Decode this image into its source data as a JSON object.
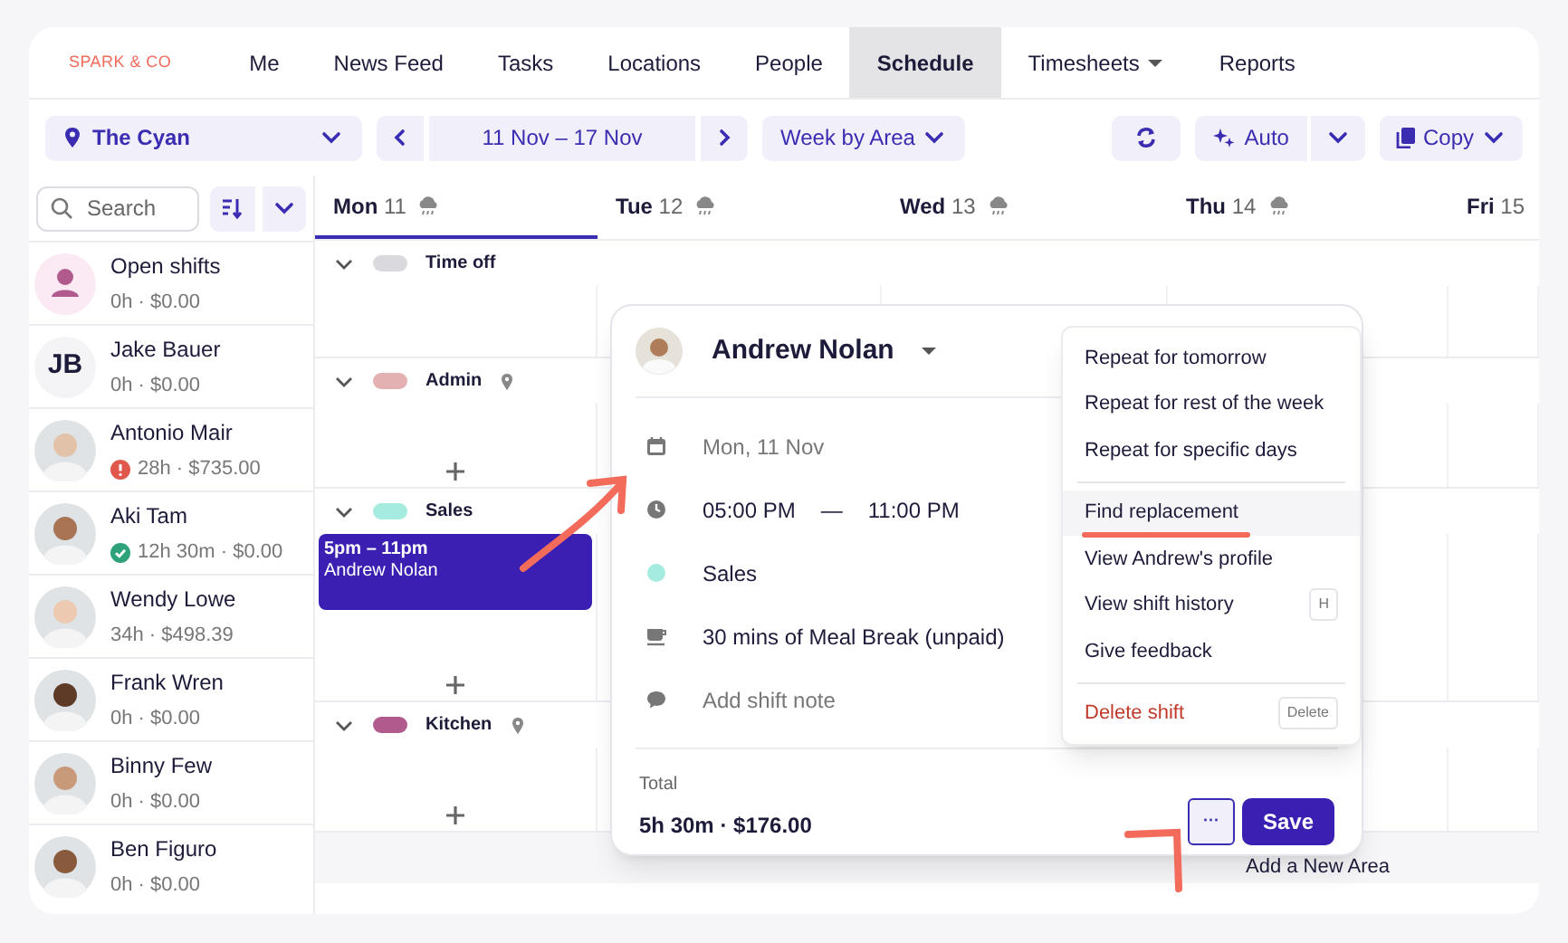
{
  "brand": "SPARK & CO",
  "nav": [
    {
      "label": "Me",
      "selected": false,
      "has_menu": false
    },
    {
      "label": "News Feed",
      "selected": false,
      "has_menu": false
    },
    {
      "label": "Tasks",
      "selected": false,
      "has_menu": false
    },
    {
      "label": "Locations",
      "selected": false,
      "has_menu": false
    },
    {
      "label": "People",
      "selected": false,
      "has_menu": false
    },
    {
      "label": "Schedule",
      "selected": true,
      "has_menu": false
    },
    {
      "label": "Timesheets",
      "selected": false,
      "has_menu": true
    },
    {
      "label": "Reports",
      "selected": false,
      "has_menu": false
    }
  ],
  "toolbar": {
    "location": "The Cyan",
    "date_range": "11 Nov – 17 Nov",
    "view": "Week by Area",
    "auto": "Auto",
    "copy": "Copy"
  },
  "search": {
    "placeholder": "Search"
  },
  "days": [
    {
      "day": "Mon",
      "date": "11",
      "selected": true
    },
    {
      "day": "Tue",
      "date": "12",
      "selected": false
    },
    {
      "day": "Wed",
      "date": "13",
      "selected": false
    },
    {
      "day": "Thu",
      "date": "14",
      "selected": false
    },
    {
      "day": "Fri",
      "date": "15",
      "selected": false
    }
  ],
  "staff": [
    {
      "name": "Open shifts",
      "summary": "0h · $0.00",
      "kind": "open",
      "alert": false,
      "confirmed": false
    },
    {
      "name": "Jake Bauer",
      "summary": "0h · $0.00",
      "kind": "initials",
      "initials": "JB",
      "alert": false,
      "confirmed": false
    },
    {
      "name": "Antonio Mair",
      "summary": "28h · $735.00",
      "kind": "photo",
      "alert": true,
      "confirmed": false
    },
    {
      "name": "Aki Tam",
      "summary": "12h 30m · $0.00",
      "kind": "photo",
      "alert": false,
      "confirmed": true
    },
    {
      "name": "Wendy Lowe",
      "summary": "34h · $498.39",
      "kind": "photo",
      "alert": false,
      "confirmed": false
    },
    {
      "name": "Frank Wren",
      "summary": "0h · $0.00",
      "kind": "photo",
      "alert": false,
      "confirmed": false
    },
    {
      "name": "Binny Few",
      "summary": "0h · $0.00",
      "kind": "photo",
      "alert": false,
      "confirmed": false
    },
    {
      "name": "Ben Figuro",
      "summary": "0h · $0.00",
      "kind": "photo",
      "alert": false,
      "confirmed": false
    }
  ],
  "areas": [
    {
      "name": "Time off",
      "color": "#d9d9de",
      "expanded": true,
      "pinned": false,
      "addable": false
    },
    {
      "name": "Admin",
      "color": "#e3b1b1",
      "expanded": true,
      "pinned": true,
      "addable": true
    },
    {
      "name": "Sales",
      "color": "#a6ebe0",
      "expanded": true,
      "pinned": false,
      "addable": true,
      "shifts": [
        {
          "time": "5pm – 11pm",
          "name": "Andrew Nolan"
        }
      ]
    },
    {
      "name": "Kitchen",
      "color": "#b05a8e",
      "expanded": true,
      "pinned": true,
      "addable": true
    }
  ],
  "add_area": "Add a New Area",
  "popup": {
    "employee": "Andrew Nolan",
    "date": "Mon, 11 Nov",
    "start": "05:00 PM",
    "dash": "—",
    "end": "11:00 PM",
    "area": {
      "label": "Sales",
      "color": "#a6ebe0"
    },
    "break": "30 mins of Meal Break (unpaid)",
    "note_placeholder": "Add shift note",
    "total_label": "Total",
    "total": "5h 30m · $176.00",
    "more": "···",
    "save": "Save"
  },
  "menu": [
    {
      "label": "Repeat for tomorrow",
      "kind": "item",
      "selected": false
    },
    {
      "label": "Repeat for rest of the week",
      "kind": "item",
      "selected": false
    },
    {
      "label": "Repeat for specific days",
      "kind": "item",
      "selected": false
    },
    {
      "label": "Find replacement",
      "kind": "item",
      "selected": true,
      "divider_before": true
    },
    {
      "label": "View Andrew's profile",
      "kind": "item",
      "selected": false
    },
    {
      "label": "View shift history",
      "kind": "item",
      "selected": false,
      "shortcut": "H"
    },
    {
      "label": "Give feedback",
      "kind": "item",
      "selected": false
    },
    {
      "label": "Delete shift",
      "kind": "danger",
      "selected": false,
      "shortcut": "Delete",
      "divider_before": true
    }
  ]
}
